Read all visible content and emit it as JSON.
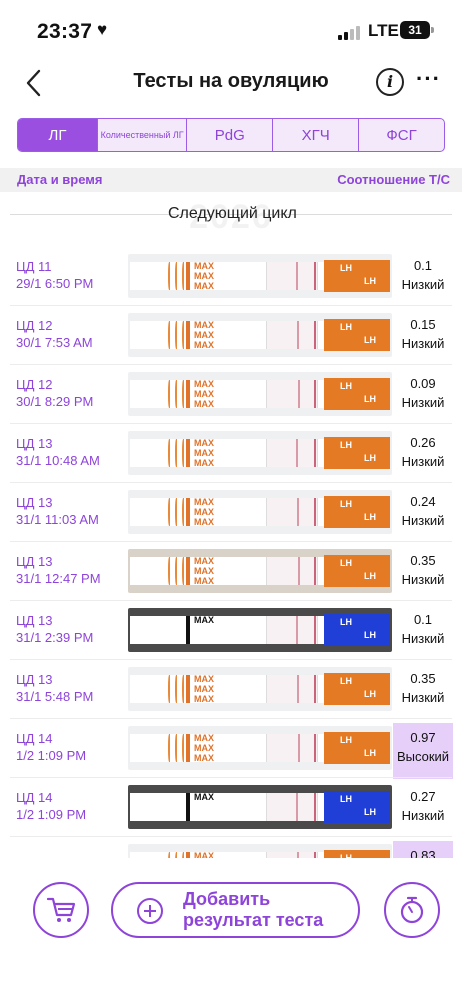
{
  "status": {
    "time": "23:37",
    "network": "LTE",
    "battery": "31"
  },
  "header": {
    "title": "Тесты на овуляцию",
    "info_label": "i",
    "more_label": "···"
  },
  "tabs": [
    {
      "label": "ЛГ",
      "active": true
    },
    {
      "label": "Количественный ЛГ",
      "active": false
    },
    {
      "label": "PdG",
      "active": false
    },
    {
      "label": "ХГЧ",
      "active": false
    },
    {
      "label": "ФСГ",
      "active": false
    }
  ],
  "columns": {
    "left": "Дата и время",
    "right": "Соотношение Т/С"
  },
  "cycle": {
    "label": "Следующий цикл",
    "year": "2026"
  },
  "strip_marker": "MAX",
  "strip_brand": "LH",
  "rows": [
    {
      "day": "ЦД 11",
      "datetime": "29/1 6:50 PM",
      "value": "0.1",
      "level": "Низкий",
      "high": false
    },
    {
      "day": "ЦД 12",
      "datetime": "30/1 7:53 AM",
      "value": "0.15",
      "level": "Низкий",
      "high": false
    },
    {
      "day": "ЦД 12",
      "datetime": "30/1 8:29 PM",
      "value": "0.09",
      "level": "Низкий",
      "high": false
    },
    {
      "day": "ЦД 13",
      "datetime": "31/1 10:48 AM",
      "value": "0.26",
      "level": "Низкий",
      "high": false
    },
    {
      "day": "ЦД 13",
      "datetime": "31/1 11:03 AM",
      "value": "0.24",
      "level": "Низкий",
      "high": false
    },
    {
      "day": "ЦД 13",
      "datetime": "31/1 12:47 PM",
      "value": "0.35",
      "level": "Низкий",
      "high": false
    },
    {
      "day": "ЦД 13",
      "datetime": "31/1 2:39 PM",
      "value": "0.1",
      "level": "Низкий",
      "high": false
    },
    {
      "day": "ЦД 13",
      "datetime": "31/1 5:48 PM",
      "value": "0.35",
      "level": "Низкий",
      "high": false
    },
    {
      "day": "ЦД 14",
      "datetime": "1/2 1:09 PM",
      "value": "0.97",
      "level": "Высокий",
      "high": true
    },
    {
      "day": "ЦД 14",
      "datetime": "1/2 1:09 PM",
      "value": "0.27",
      "level": "Низкий",
      "high": false
    },
    {
      "day": "",
      "datetime": "",
      "value": "0.83",
      "level": "",
      "high": true
    }
  ],
  "bottom": {
    "add_label": "Добавить результат теста"
  },
  "colors": {
    "accent": "#8e44d9",
    "strip_orange": "#e47a23",
    "strip_blue": "#1f3fd6",
    "high_bg": "#e6cff8"
  }
}
